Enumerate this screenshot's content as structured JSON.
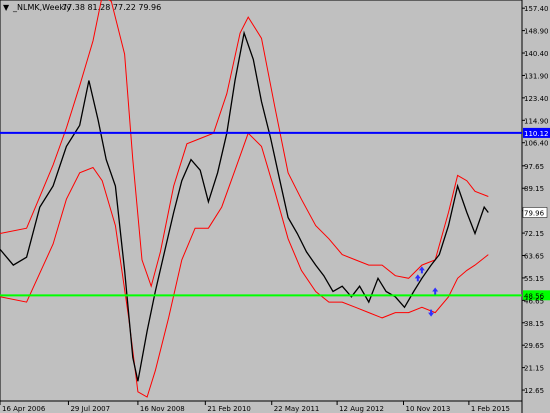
{
  "window": {
    "symbol_label": "_NLMK,Weekly",
    "ohlc_text": "77.38 81.28 77.22 79.96",
    "menu_glyph": "▼"
  },
  "colors": {
    "background": "#c0c0c0",
    "price": "#000000",
    "bands": "#ff0000",
    "resistance": "#0000ff",
    "support": "#00ff00",
    "arrows": "#3030ff"
  },
  "chart_data": {
    "type": "line",
    "title": "",
    "xlabel": "",
    "ylabel": "",
    "y_axis_side": "right",
    "ylim": [
      8.5,
      160.5
    ],
    "xlim": [
      "2006-04-16",
      "2016-01-31"
    ],
    "grid": false,
    "yticks": [
      "157.40",
      "148.90",
      "140.40",
      "131.90",
      "123.40",
      "114.90",
      "106.40",
      "97.65",
      "89.15",
      "80.65",
      "72.15",
      "63.65",
      "55.15",
      "46.65",
      "38.15",
      "29.65",
      "21.15",
      "12.65"
    ],
    "ytick_values": [
      157.4,
      148.9,
      140.4,
      131.9,
      123.4,
      114.9,
      106.4,
      97.65,
      89.15,
      80.65,
      72.15,
      63.65,
      55.15,
      46.65,
      38.15,
      29.65,
      21.15,
      12.65
    ],
    "xticks": [
      {
        "label": "16 Apr 2006",
        "date": "2006-04-16"
      },
      {
        "label": "29 Jul 2007",
        "date": "2007-07-29"
      },
      {
        "label": "16 Nov 2008",
        "date": "2008-11-16"
      },
      {
        "label": "21 Feb 2010",
        "date": "2010-02-21"
      },
      {
        "label": "22 May 2011",
        "date": "2011-05-22"
      },
      {
        "label": "12 Aug 2012",
        "date": "2012-08-12"
      },
      {
        "label": "10 Nov 2013",
        "date": "2013-11-10"
      },
      {
        "label": "1 Feb 2015",
        "date": "2015-02-01"
      }
    ],
    "hlines": [
      {
        "label": "110.12",
        "value": 110.12,
        "color": "#0000ff"
      },
      {
        "label": "48.56",
        "value": 48.56,
        "color": "#00ff00"
      }
    ],
    "last_price": {
      "label": "79.96",
      "value": 79.96
    },
    "series": [
      {
        "role": "price",
        "color": "#000000",
        "points": [
          [
            "2006-04-16",
            66
          ],
          [
            "2006-07-16",
            60
          ],
          [
            "2006-10-15",
            63
          ],
          [
            "2007-01-14",
            82
          ],
          [
            "2007-04-15",
            90
          ],
          [
            "2007-07-15",
            105
          ],
          [
            "2007-10-14",
            113
          ],
          [
            "2007-12-16",
            130
          ],
          [
            "2008-02-17",
            115
          ],
          [
            "2008-04-13",
            100
          ],
          [
            "2008-06-15",
            90
          ],
          [
            "2008-08-17",
            58
          ],
          [
            "2008-10-12",
            25
          ],
          [
            "2008-11-16",
            16
          ],
          [
            "2009-01-18",
            35
          ],
          [
            "2009-03-15",
            50
          ],
          [
            "2009-05-17",
            65
          ],
          [
            "2009-07-19",
            80
          ],
          [
            "2009-09-13",
            92
          ],
          [
            "2009-11-15",
            100
          ],
          [
            "2010-01-17",
            96
          ],
          [
            "2010-03-14",
            84
          ],
          [
            "2010-05-16",
            95
          ],
          [
            "2010-07-18",
            110
          ],
          [
            "2010-09-12",
            130
          ],
          [
            "2010-11-14",
            148
          ],
          [
            "2011-01-16",
            138
          ],
          [
            "2011-03-13",
            122
          ],
          [
            "2011-05-15",
            108
          ],
          [
            "2011-07-17",
            92
          ],
          [
            "2011-09-11",
            78
          ],
          [
            "2011-11-13",
            72
          ],
          [
            "2012-01-15",
            65
          ],
          [
            "2012-03-18",
            60
          ],
          [
            "2012-05-13",
            56
          ],
          [
            "2012-07-15",
            50
          ],
          [
            "2012-09-16",
            52
          ],
          [
            "2012-11-18",
            48
          ],
          [
            "2013-01-13",
            52
          ],
          [
            "2013-03-17",
            46
          ],
          [
            "2013-05-19",
            55
          ],
          [
            "2013-07-14",
            50
          ],
          [
            "2013-09-15",
            48
          ],
          [
            "2013-11-17",
            44
          ],
          [
            "2014-01-19",
            50
          ],
          [
            "2014-03-16",
            55
          ],
          [
            "2014-05-18",
            60
          ],
          [
            "2014-07-13",
            64
          ],
          [
            "2014-09-14",
            75
          ],
          [
            "2014-11-16",
            90
          ],
          [
            "2015-01-18",
            80
          ],
          [
            "2015-03-15",
            72
          ],
          [
            "2015-05-17",
            82
          ],
          [
            "2015-06-14",
            79.96
          ]
        ]
      },
      {
        "role": "upper-band",
        "color": "#ff0000",
        "points": [
          [
            "2006-04-16",
            72
          ],
          [
            "2006-10-15",
            74
          ],
          [
            "2007-04-15",
            98
          ],
          [
            "2007-07-15",
            112
          ],
          [
            "2007-10-14",
            128
          ],
          [
            "2008-01-13",
            145
          ],
          [
            "2008-03-16",
            162
          ],
          [
            "2008-05-18",
            160
          ],
          [
            "2008-08-17",
            140
          ],
          [
            "2008-10-12",
            100
          ],
          [
            "2008-12-14",
            62
          ],
          [
            "2009-02-15",
            52
          ],
          [
            "2009-04-19",
            65
          ],
          [
            "2009-07-19",
            90
          ],
          [
            "2009-10-18",
            106
          ],
          [
            "2010-01-17",
            108
          ],
          [
            "2010-04-18",
            110
          ],
          [
            "2010-07-18",
            125
          ],
          [
            "2010-10-17",
            148
          ],
          [
            "2010-12-12",
            154
          ],
          [
            "2011-03-13",
            146
          ],
          [
            "2011-06-12",
            120
          ],
          [
            "2011-09-11",
            95
          ],
          [
            "2011-12-11",
            85
          ],
          [
            "2012-03-18",
            75
          ],
          [
            "2012-06-17",
            70
          ],
          [
            "2012-09-16",
            64
          ],
          [
            "2012-12-16",
            62
          ],
          [
            "2013-03-17",
            60
          ],
          [
            "2013-06-16",
            60
          ],
          [
            "2013-09-15",
            56
          ],
          [
            "2013-12-15",
            55
          ],
          [
            "2014-03-16",
            60
          ],
          [
            "2014-06-15",
            62
          ],
          [
            "2014-09-14",
            80
          ],
          [
            "2014-11-16",
            94
          ],
          [
            "2015-01-18",
            92
          ],
          [
            "2015-03-15",
            88
          ],
          [
            "2015-06-14",
            86
          ]
        ]
      },
      {
        "role": "lower-band",
        "color": "#ff0000",
        "points": [
          [
            "2006-04-16",
            48
          ],
          [
            "2006-10-15",
            46
          ],
          [
            "2007-04-15",
            68
          ],
          [
            "2007-07-15",
            85
          ],
          [
            "2007-10-14",
            95
          ],
          [
            "2008-01-13",
            97
          ],
          [
            "2008-03-16",
            92
          ],
          [
            "2008-06-15",
            75
          ],
          [
            "2008-09-14",
            40
          ],
          [
            "2008-11-16",
            12
          ],
          [
            "2009-01-18",
            10
          ],
          [
            "2009-03-15",
            20
          ],
          [
            "2009-06-14",
            40
          ],
          [
            "2009-09-13",
            62
          ],
          [
            "2009-12-13",
            74
          ],
          [
            "2010-03-14",
            74
          ],
          [
            "2010-06-13",
            82
          ],
          [
            "2010-09-12",
            96
          ],
          [
            "2010-12-12",
            110
          ],
          [
            "2011-03-13",
            105
          ],
          [
            "2011-06-12",
            88
          ],
          [
            "2011-09-11",
            70
          ],
          [
            "2011-12-11",
            58
          ],
          [
            "2012-03-18",
            50
          ],
          [
            "2012-06-17",
            46
          ],
          [
            "2012-09-16",
            46
          ],
          [
            "2012-12-16",
            44
          ],
          [
            "2013-03-17",
            42
          ],
          [
            "2013-06-16",
            40
          ],
          [
            "2013-09-15",
            42
          ],
          [
            "2013-12-15",
            42
          ],
          [
            "2014-03-16",
            44
          ],
          [
            "2014-06-15",
            42
          ],
          [
            "2014-09-14",
            48
          ],
          [
            "2014-11-16",
            55
          ],
          [
            "2015-01-18",
            58
          ],
          [
            "2015-03-15",
            60
          ],
          [
            "2015-06-14",
            64
          ]
        ]
      }
    ],
    "markers": [
      {
        "type": "arrow-up",
        "date": "2014-02-16",
        "value": 55
      },
      {
        "type": "arrow-up",
        "date": "2014-03-16",
        "value": 58
      },
      {
        "type": "arrow-down",
        "date": "2014-05-18",
        "value": 42
      },
      {
        "type": "arrow-up",
        "date": "2014-06-15",
        "value": 50
      }
    ]
  }
}
